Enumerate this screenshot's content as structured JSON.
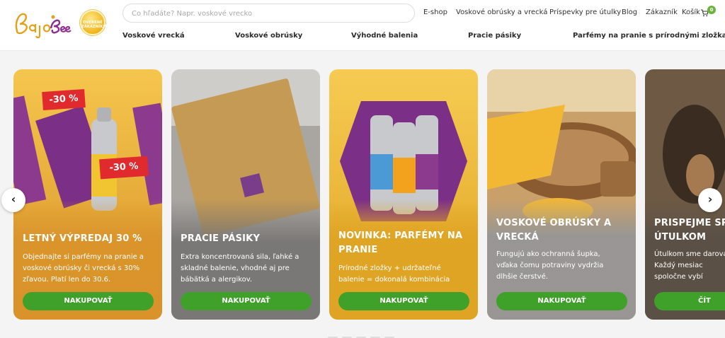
{
  "brand": {
    "logo_text": "Bajo Bee",
    "badge_text": "OVERENÉ ZÁKAZNÍKMI"
  },
  "search": {
    "placeholder": "Čo hľadáte? Napr. voskové vrecko"
  },
  "top_nav": [
    {
      "label": "E-shop"
    },
    {
      "label": "Voskové obrúsky a vrecká"
    },
    {
      "label": "Príspevky pre útulky"
    },
    {
      "label": "Blog"
    },
    {
      "label": "Zákazník"
    },
    {
      "label": "Košík"
    }
  ],
  "cart": {
    "count": "0",
    "icon": "cart-icon"
  },
  "category_nav": [
    {
      "label": "Voskové vrecká"
    },
    {
      "label": "Voskové obrúsky"
    },
    {
      "label": "Výhodné balenia"
    },
    {
      "label": "Pracie pásiky"
    },
    {
      "label": "Parfémy na pranie s prírodnými zložkami"
    }
  ],
  "slider": {
    "prev_icon": "chevron-left-icon",
    "next_icon": "chevron-right-icon",
    "prev_glyph": "‹",
    "next_glyph": "›",
    "cards": [
      {
        "title_lines": [
          "LETNÝ VÝPREDAJ 30 %"
        ],
        "description_lines": [
          "Objednajte si parfémy na pranie a",
          "voskové obrúsky či vrecká s 30%",
          "zľavou. Platí len do 30.6."
        ],
        "button": "NAKUPOVAŤ",
        "stickers": [
          "-30 %",
          "-30 %"
        ],
        "color": "#e9a92f"
      },
      {
        "title_lines": [
          "PRACIE PÁSIKY"
        ],
        "description_lines": [
          "Extra koncentrovaná sila, ľahké a",
          "skladné balenie, vhodné aj pre",
          "bábätká a alergikov."
        ],
        "button": "NAKUPOVAŤ",
        "color": "#8d8a86"
      },
      {
        "title_lines": [
          "NOVINKA: PARFÉMY NA",
          "PRANIE"
        ],
        "description_lines": [
          "Prírodné zložky + udržateľné",
          "balenie = dokonalá kombinácia"
        ],
        "button": "NAKUPOVAŤ",
        "color": "#e9b12c"
      },
      {
        "title_lines": [
          "VOSKOVÉ OBRÚSKY A",
          "VRECKÁ"
        ],
        "description_lines": [
          "Fungujú ako ochranná šupka,",
          "vďaka čomu potraviny vydržia",
          "dlhšie čerstvé."
        ],
        "button": "NAKUPOVAŤ",
        "color": "#d8a04a"
      },
      {
        "title_lines": [
          "PRISPEJME SPOLU",
          "ÚTULKOM"
        ],
        "description_lines": [
          "Útulkom sme darovali",
          "Každý mesiac",
          "spoločne vybí"
        ],
        "button": "ČÍT",
        "color": "#6e5a44"
      }
    ]
  }
}
